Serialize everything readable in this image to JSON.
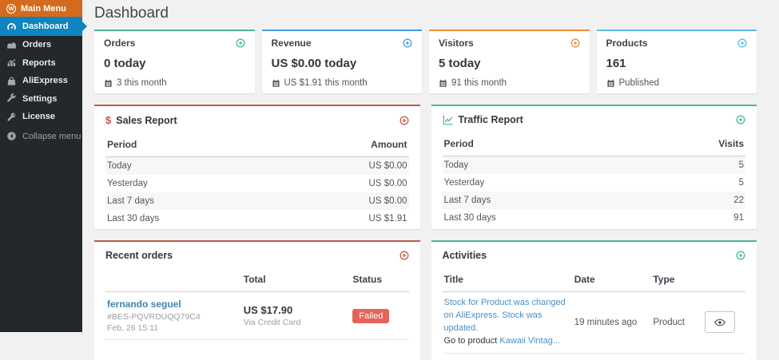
{
  "colors": {
    "sidebar_bg": "#23282d",
    "menu_header_orange": "#d46a1e",
    "active_item_blue": "#0e85be",
    "content_bg": "#f1f1f1",
    "accent_teal": "#4db39c",
    "accent_blue": "#459bdb",
    "accent_orange": "#ea8f3c",
    "accent_light_blue": "#55bde8",
    "accent_red": "#c4574a",
    "failed_badge_red": "#e4635a",
    "link_blue": "#4a8fc7"
  },
  "sidebar": {
    "main_menu": {
      "label": "Main Menu",
      "logo_glyph": "W",
      "icon": "wordpress-logo-icon"
    },
    "items": [
      {
        "label": "Dashboard",
        "icon": "gauge-icon",
        "active": true
      },
      {
        "label": "Orders",
        "icon": "area-chart-icon",
        "active": false
      },
      {
        "label": "Reports",
        "icon": "bar-chart-icon",
        "active": false
      },
      {
        "label": "AliExpress",
        "icon": "shopping-bag-icon",
        "active": false
      },
      {
        "label": "Settings",
        "icon": "wrench-icon",
        "active": false
      },
      {
        "label": "License",
        "icon": "key-icon",
        "active": false
      },
      {
        "label": "Collapse menu",
        "icon": "collapse-circle-icon",
        "active": false
      }
    ]
  },
  "page": {
    "title": "Dashboard"
  },
  "stat_cards": [
    {
      "label": "Orders",
      "value": "0 today",
      "sub": "3 this month",
      "accent": "#4db39c",
      "icon": "circle-plus-icon"
    },
    {
      "label": "Revenue",
      "value": "US $0.00 today",
      "sub": "US $1.91 this month",
      "accent": "#459bdb",
      "icon": "circle-plus-icon"
    },
    {
      "label": "Visitors",
      "value": "5 today",
      "sub": "91 this month",
      "accent": "#ea8f3c",
      "icon": "circle-plus-icon"
    },
    {
      "label": "Products",
      "value": "161",
      "sub": "Published",
      "accent": "#55bde8",
      "icon": "circle-plus-icon"
    }
  ],
  "sales_report": {
    "title": "Sales Report",
    "glyph": "$",
    "accent": "#c4574a",
    "columns": {
      "period": "Period",
      "amount": "Amount"
    },
    "rows": [
      {
        "period": "Today",
        "amount": "US $0.00"
      },
      {
        "period": "Yesterday",
        "amount": "US $0.00"
      },
      {
        "period": "Last 7 days",
        "amount": "US $0.00"
      },
      {
        "period": "Last 30 days",
        "amount": "US $1.91"
      }
    ]
  },
  "traffic_report": {
    "title": "Traffic Report",
    "accent": "#4db39c",
    "columns": {
      "period": "Period",
      "visits": "Visits"
    },
    "rows": [
      {
        "period": "Today",
        "visits": "5"
      },
      {
        "period": "Yesterday",
        "visits": "5"
      },
      {
        "period": "Last 7 days",
        "visits": "22"
      },
      {
        "period": "Last 30 days",
        "visits": "91"
      }
    ]
  },
  "recent_orders": {
    "title": "Recent orders",
    "accent": "#c4574a",
    "columns": {
      "customer": "",
      "total": "Total",
      "status": "Status"
    },
    "order": {
      "customer": "fernando seguel",
      "order_id": "#BES-PQVRDUQQ79C4",
      "date": "Feb, 26 15:11",
      "total": "US $17.90",
      "payment": "Via Credit Card",
      "status": "Failed"
    }
  },
  "activities": {
    "title": "Activities",
    "accent": "#4db39c",
    "columns": {
      "title": "Title",
      "date": "Date",
      "type": "Type"
    },
    "activity": {
      "title_link": "Stock for Product was changed on AliExpress. Stock was updated.",
      "goto_text": "Go to product",
      "product_link": "Kawaii Vintag...",
      "date": "19 minutes ago",
      "type": "Product",
      "action_icon": "eye-icon"
    }
  }
}
